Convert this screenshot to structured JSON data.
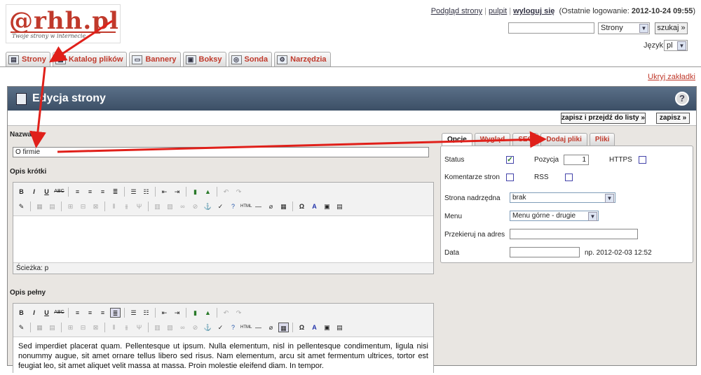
{
  "logo": {
    "text": "@rhh.pl",
    "tagline": "Twoje strony w internecie"
  },
  "toplinks": {
    "preview": "Podgląd strony",
    "desktop": "pulpit",
    "logout": "wyloguj się",
    "last_login_prefix": "(Ostatnie logowanie: ",
    "last_login_value": "2012-10-24 09:55",
    "last_login_suffix": ")"
  },
  "search": {
    "value": "",
    "scope": "Strony",
    "button": "szukaj »"
  },
  "language": {
    "label": "Język:",
    "value": "pl"
  },
  "tabs": [
    {
      "label": "Strony",
      "icon": "pages-icon"
    },
    {
      "label": "Katalog plików",
      "icon": "files-icon"
    },
    {
      "label": "Bannery",
      "icon": "banner-icon"
    },
    {
      "label": "Boksy",
      "icon": "boxes-icon"
    },
    {
      "label": "Sonda",
      "icon": "poll-icon"
    },
    {
      "label": "Narzędzia",
      "icon": "tools-icon"
    }
  ],
  "hide_tabs": "Ukryj zakładki",
  "panel": {
    "title": "Edycja strony",
    "help": "?"
  },
  "buttons": {
    "save_and_list": "zapisz i przejdź do listy »",
    "save": "zapisz »"
  },
  "form": {
    "name_label": "Nazwa",
    "name_value": "O firmie",
    "short_label": "Opis krótki",
    "short_path": "Ścieżka: p",
    "full_label": "Opis pełny",
    "full_text": "Sed imperdiet placerat quam. Pellentesque ut ipsum. Nulla elementum, nisl in pellentesque condimentum, ligula nisi nonummy augue, sit amet ornare tellus libero sed risus. Nam elementum, arcu sit amet fermentum ultrices, tortor est feugiat leo, sit amet aliquet velit massa at massa. Proin molestie eleifend diam. In tempor."
  },
  "right_tabs": [
    "Opcje",
    "Wygląd",
    "SEO",
    "Dodaj pliki",
    "Pliki"
  ],
  "options": {
    "status": "Status",
    "status_checked": true,
    "position": "Pozycja",
    "position_value": "1",
    "https": "HTTPS",
    "comments": "Komentarze stron",
    "rss": "RSS",
    "parent": "Strona nadrzędna",
    "parent_value": "brak",
    "menu": "Menu",
    "menu_value": "Menu górne - drugie",
    "redirect": "Przekieruj na adres",
    "redirect_value": "",
    "date": "Data",
    "date_value": "",
    "date_hint": "np. 2012-02-03 12:52"
  },
  "colors": {
    "accent": "#c0392b",
    "header": "#4a5e76",
    "arrow": "#e0201a"
  }
}
